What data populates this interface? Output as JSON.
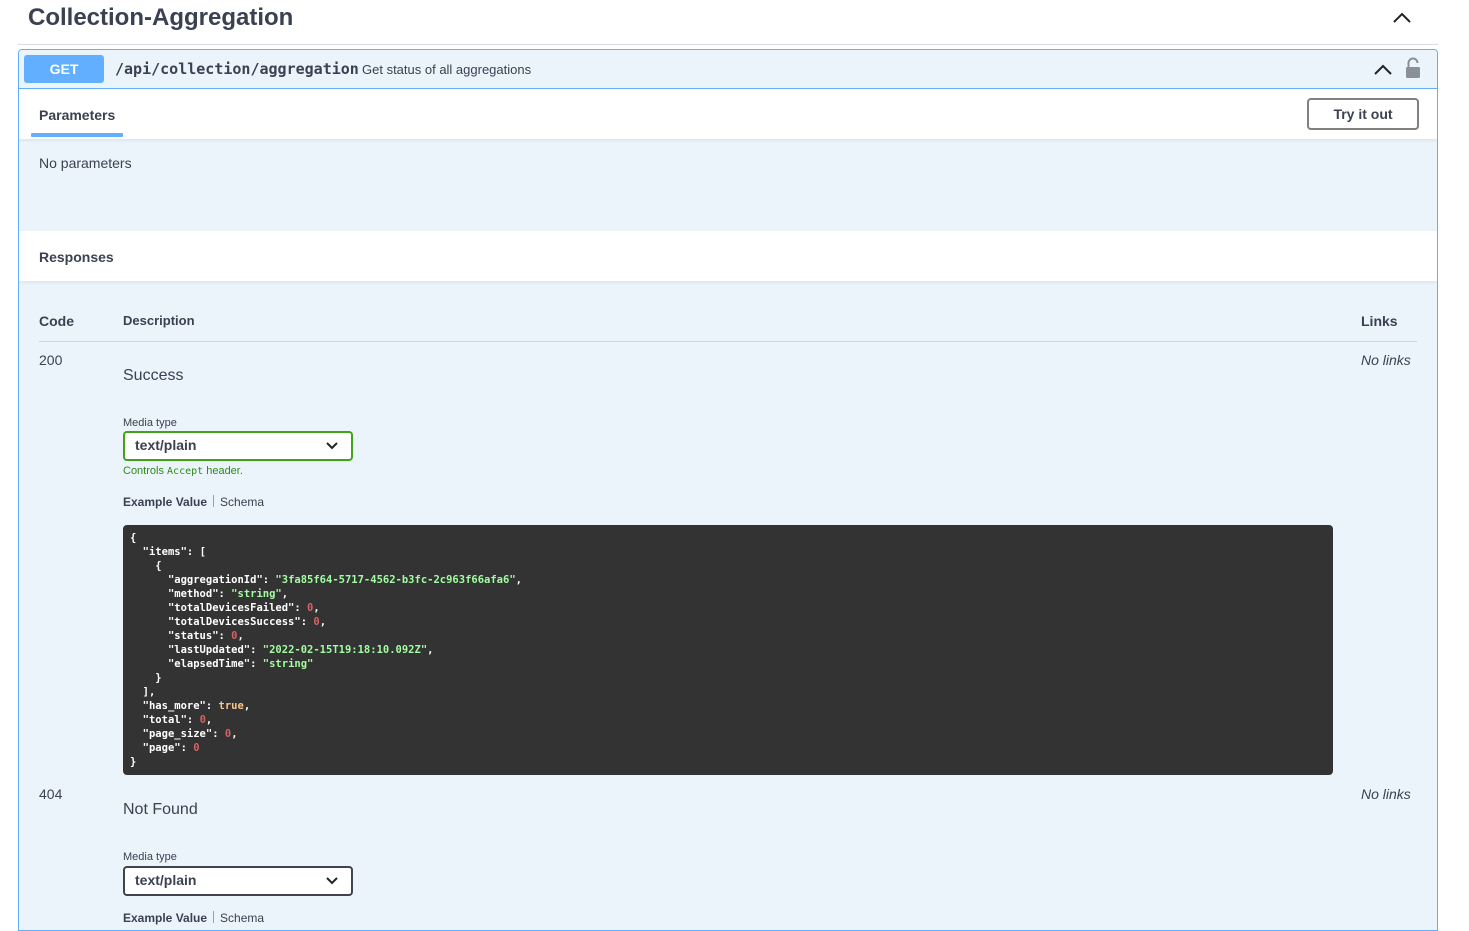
{
  "section": {
    "title": "Collection-Aggregation"
  },
  "endpoint": {
    "method": "GET",
    "path": "/api/collection/aggregation",
    "description": "Get status of all aggregations"
  },
  "tabs": {
    "parameters": "Parameters",
    "try_it_out": "Try it out"
  },
  "parameters": {
    "empty_text": "No parameters"
  },
  "responses": {
    "title": "Responses",
    "columns": {
      "code": "Code",
      "description": "Description",
      "links": "Links"
    },
    "items": [
      {
        "code": "200",
        "description": "Success",
        "links": "No links",
        "media_type_label": "Media type",
        "media_type": "text/plain",
        "controls_prefix": "Controls ",
        "controls_code": "Accept",
        "controls_suffix": " header.",
        "example_tab": "Example Value",
        "schema_tab": "Schema"
      },
      {
        "code": "404",
        "description": "Not Found",
        "links": "No links",
        "media_type_label": "Media type",
        "media_type": "text/plain",
        "example_tab": "Example Value",
        "schema_tab": "Schema"
      }
    ]
  },
  "example_json": {
    "items_key": "\"items\"",
    "aggregation_id_key": "\"aggregationId\"",
    "aggregation_id_val": "\"3fa85f64-5717-4562-b3fc-2c963f66afa6\"",
    "method_key": "\"method\"",
    "method_val": "\"string\"",
    "failed_key": "\"totalDevicesFailed\"",
    "failed_val": "0",
    "success_key": "\"totalDevicesSuccess\"",
    "success_val": "0",
    "status_key": "\"status\"",
    "status_val": "0",
    "updated_key": "\"lastUpdated\"",
    "updated_val": "\"2022-02-15T19:18:10.092Z\"",
    "elapsed_key": "\"elapsedTime\"",
    "elapsed_val": "\"string\"",
    "has_more_key": "\"has_more\"",
    "has_more_val": "true",
    "total_key": "\"total\"",
    "total_val": "0",
    "page_size_key": "\"page_size\"",
    "page_size_val": "0",
    "page_key": "\"page\"",
    "page_val": "0"
  },
  "colors": {
    "get_method": "#61affe",
    "block_bg": "#ebf3fb",
    "valid_select": "#41a317",
    "code_bg": "#333333"
  },
  "icons": {
    "section_toggle": "chevron-up-icon",
    "summary_toggle": "chevron-up-icon",
    "auth": "lock-icon",
    "select_arrow": "chevron-down-icon"
  }
}
